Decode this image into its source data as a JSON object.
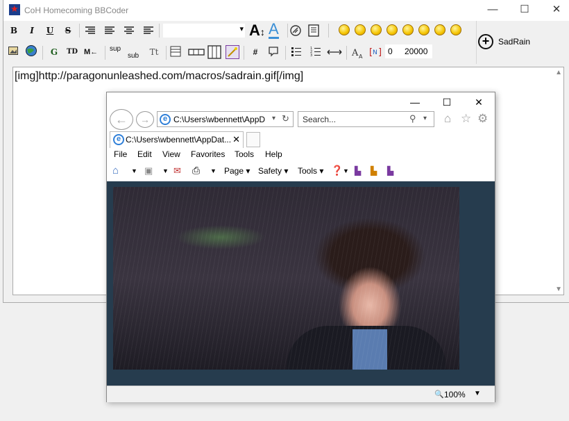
{
  "app": {
    "title": "CoH Homecoming BBCoder",
    "minimize_glyph": "—",
    "maximize_glyph": "☐",
    "close_glyph": "✕"
  },
  "toolbar": {
    "row1": {
      "bold": "B",
      "italic": "I",
      "underline": "U",
      "strike": "S",
      "align_left_icon": "align-left-icon",
      "align_justify_icon": "align-justify-icon",
      "align_center_icon": "align-center-icon",
      "align_right_icon": "align-right-icon",
      "font_dropdown_value": "",
      "font_size_label": "A",
      "font_color_label": "A",
      "smileys": [
        "smile",
        "shocked",
        "cool",
        "surprised",
        "eek",
        "grin",
        "laugh",
        "wink"
      ]
    },
    "row2": {
      "sup": "sup",
      "sub": "sub",
      "tt": "Tt",
      "hash": "#",
      "num_a": "0",
      "num_b": "20000",
      "g_label": "G",
      "td_label": "TD",
      "m_label": "M←"
    },
    "sadrain_label": "SadRain"
  },
  "editor": {
    "text": "[img]http://paragonunleashed.com/macros/sadrain.gif[/img]"
  },
  "ie": {
    "address": "C:\\Users\\wbennett\\AppD",
    "search_placeholder": "Search...",
    "tab_label": "C:\\Users\\wbennett\\AppDat...",
    "menu": [
      "File",
      "Edit",
      "View",
      "Favorites",
      "Tools",
      "Help"
    ],
    "commands": {
      "page": "Page ▾",
      "safety": "Safety ▾",
      "tools": "Tools ▾"
    },
    "zoom": "100%"
  }
}
